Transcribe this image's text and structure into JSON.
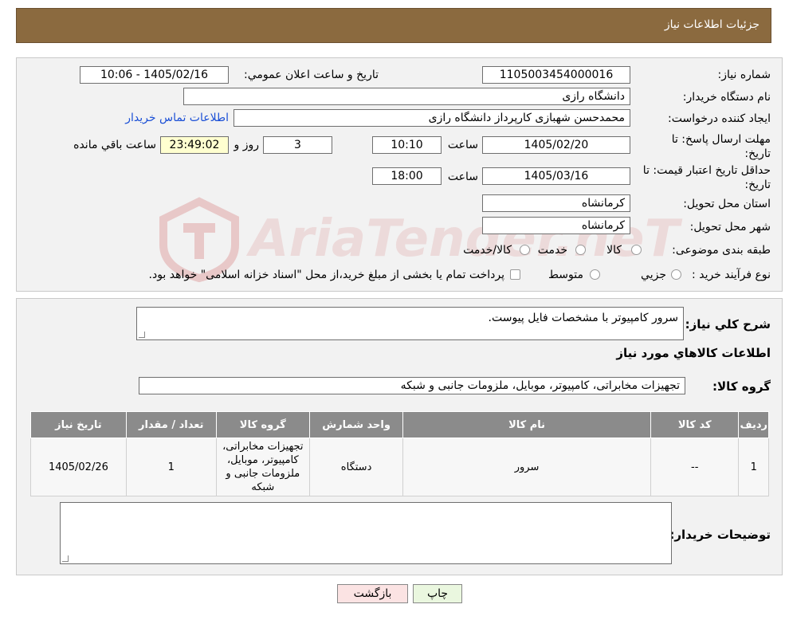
{
  "header": {
    "title": "جزئیات اطلاعات نیاز"
  },
  "fields": {
    "need_number_label": "شماره نیاز:",
    "need_number": "1105003454000016",
    "announce_label": "تاریخ و ساعت اعلان عمومي:",
    "announce_value": "1405/02/16 - 10:06",
    "buyer_org_label": "نام دستگاه خریدار:",
    "buyer_org": "دانشگاه رازی",
    "creator_label": "ایجاد کننده درخواست:",
    "creator": "محمدحسن شهبازی کارپرداز دانشگاه رازی",
    "contact_link": "اطلاعات تماس خریدار",
    "deadline_label": "مهلت ارسال پاسخ: تا تاریخ:",
    "deadline_date": "1405/02/20",
    "time_label": "ساعت",
    "deadline_time": "10:10",
    "days_value": "3",
    "days_label": "روز و",
    "remaining_time": "23:49:02",
    "remaining_label": "ساعت باقي مانده",
    "validity_label": "حداقل تاریخ اعتبار قیمت: تا تاریخ:",
    "validity_date": "1405/03/16",
    "validity_time": "18:00",
    "province_label": "استان محل تحویل:",
    "province": "کرمانشاه",
    "city_label": "شهر محل تحویل:",
    "city": "کرمانشاه",
    "category_label": "طبقه بندی موضوعی:",
    "category_options": [
      "کالا",
      "خدمت",
      "کالا/خدمت"
    ],
    "process_label": "نوع فرآیند خرید :",
    "process_options": [
      "جزیي",
      "متوسط"
    ],
    "process_note": "پرداخت تمام یا بخشی از مبلغ خرید،از محل \"اسناد خزانه اسلامی\" خواهد بود."
  },
  "description": {
    "label": "شرح کلي نیاز:",
    "value": "سرور کامپیوتر با مشخصات فایل پیوست."
  },
  "items_section": {
    "title": "اطلاعات کالاهاي مورد نیاز",
    "group_label": "گروه کالا:",
    "group_value": "تجهیزات مخابراتی، کامپیوتر، موبایل، ملزومات جانبی و شبکه"
  },
  "table": {
    "headers": [
      "ردیف",
      "کد کالا",
      "نام کالا",
      "واحد شمارش",
      "گروه کالا",
      "تعداد / مقدار",
      "تاریخ نیاز"
    ],
    "rows": [
      [
        "1",
        "--",
        "سرور",
        "دستگاه",
        "تجهیزات مخابراتی، کامپیوتر، موبایل، ملزومات جانبی و شبکه",
        "1",
        "1405/02/26"
      ]
    ]
  },
  "buyer_notes": {
    "label": "توضیحات خریدار:",
    "value": ""
  },
  "buttons": {
    "print": "چاپ",
    "back": "بازگشت"
  },
  "watermark": {
    "text": "AriaTender.neT"
  },
  "colors": {
    "header": "#8b6a3f",
    "table_header": "#8b8b8b",
    "back_button": "#fbe3e3",
    "print_button": "#eaf7df"
  }
}
